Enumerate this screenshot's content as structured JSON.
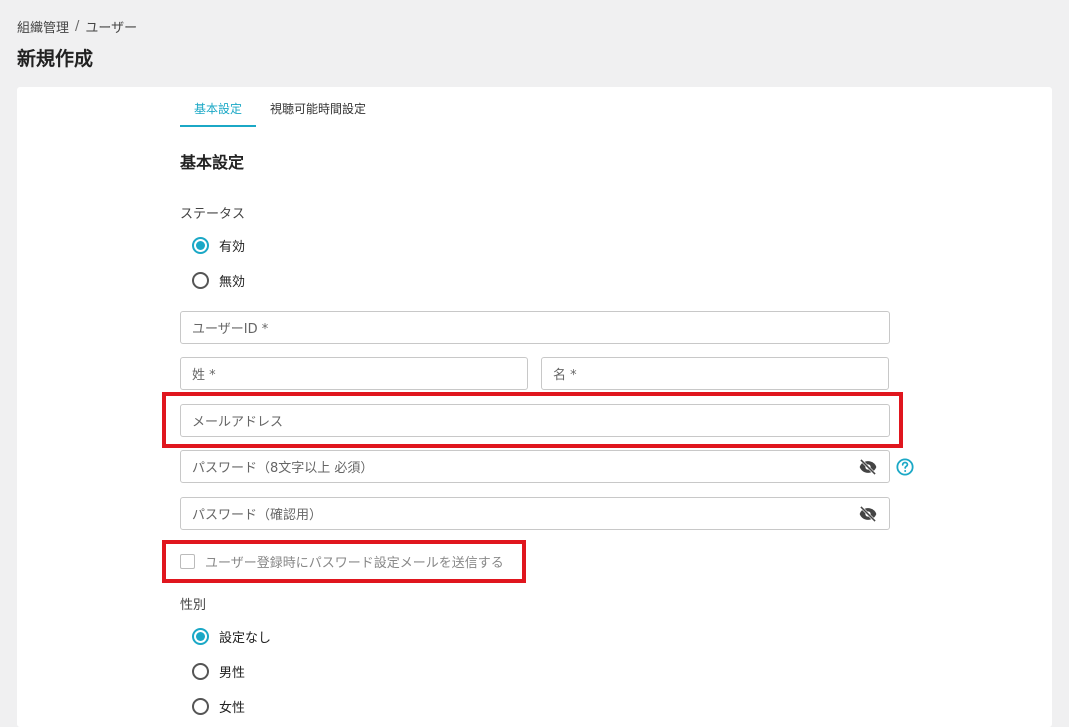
{
  "breadcrumb": {
    "parent": "組織管理",
    "separator": "/",
    "current": "ユーザー"
  },
  "page_title": "新規作成",
  "tabs": [
    {
      "label": "基本設定",
      "active": true
    },
    {
      "label": "視聴可能時間設定",
      "active": false
    }
  ],
  "section_title": "基本設定",
  "status": {
    "label": "ステータス",
    "options": [
      {
        "label": "有効",
        "checked": true
      },
      {
        "label": "無効",
        "checked": false
      }
    ]
  },
  "fields": {
    "user_id": "ユーザーID *",
    "last_name": "姓 *",
    "first_name": "名 *",
    "email": "メールアドレス",
    "password": "パスワード（8文字以上 必須）",
    "password_confirm": "パスワード（確認用）"
  },
  "send_mail_checkbox": {
    "label": "ユーザー登録時にパスワード設定メールを送信する",
    "checked": false
  },
  "gender": {
    "label": "性別",
    "options": [
      {
        "label": "設定なし",
        "checked": true
      },
      {
        "label": "男性",
        "checked": false
      },
      {
        "label": "女性",
        "checked": false
      }
    ]
  },
  "colors": {
    "accent": "#1ba8c6",
    "highlight": "#e0161e"
  },
  "icons": {
    "password_toggle": "eye-off-icon",
    "help": "question-circle-icon"
  }
}
